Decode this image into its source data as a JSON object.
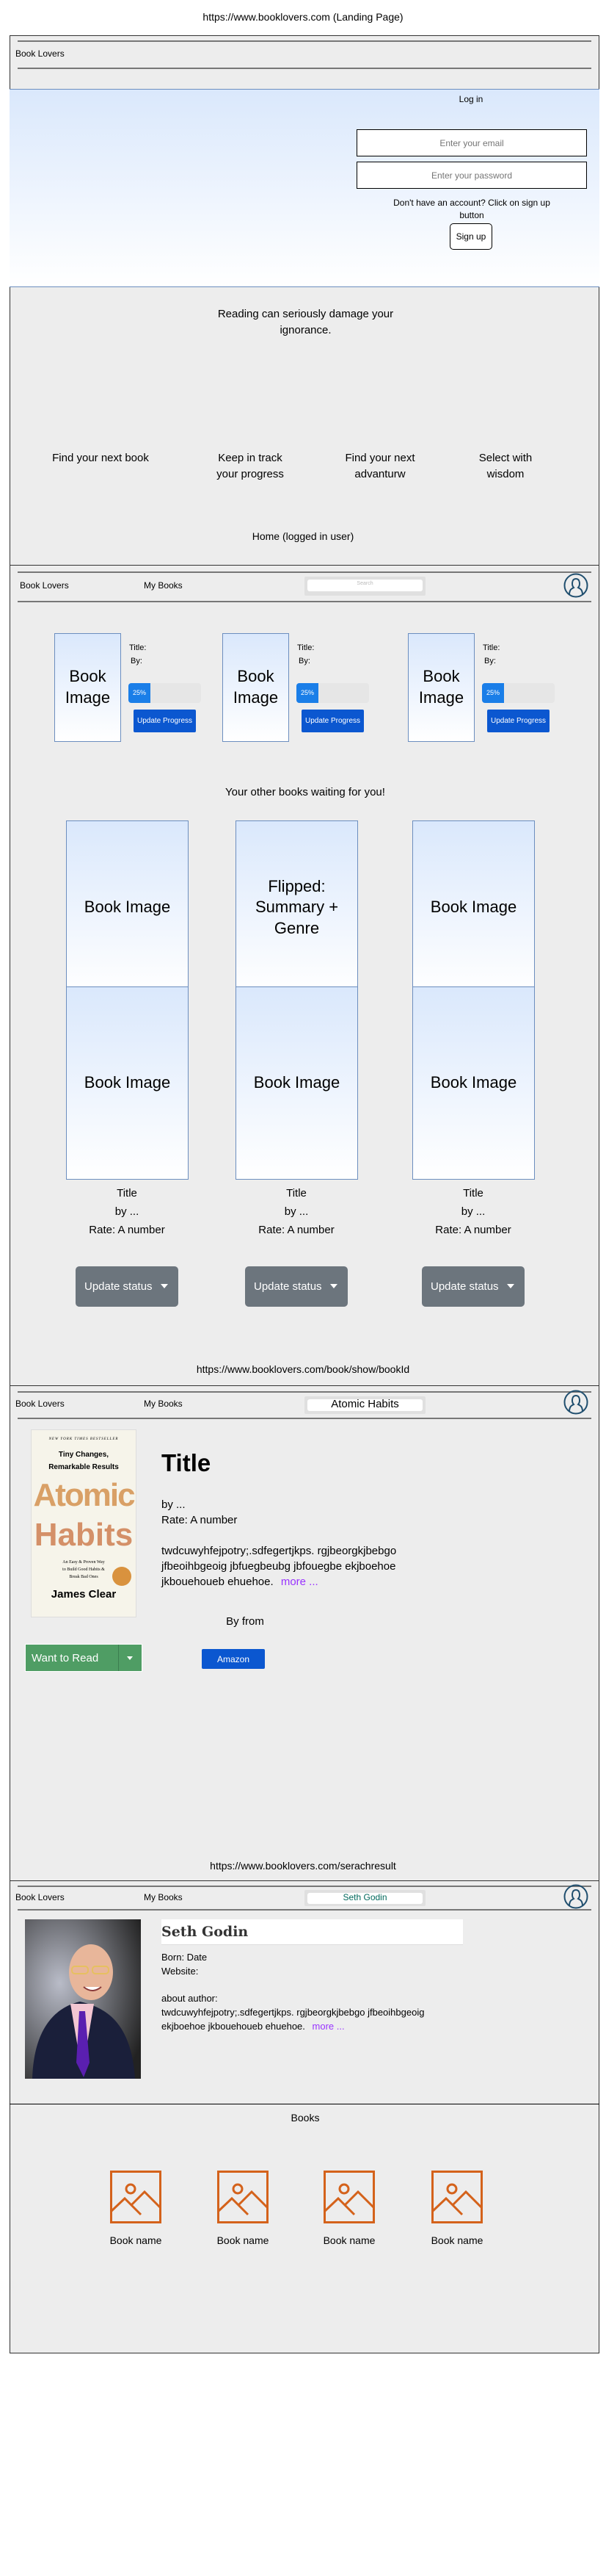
{
  "landing": {
    "caption": "https://www.booklovers.com (Landing Page)",
    "brand": "Book Lovers",
    "login_title": "Log in",
    "email_placeholder": "Enter your email",
    "password_placeholder": "Enter your password",
    "signup_hint": "Don't have an account? Click on sign up button",
    "signup_button": "Sign up",
    "quote": "Reading can seriously damage your ignorance.",
    "features": [
      "Find your next book",
      "Keep in track your progress",
      "Find your next advanturw",
      "Select with wisdom"
    ]
  },
  "home": {
    "caption": "Home (logged in user)",
    "nav": {
      "brand": "Book Lovers",
      "my_books": "My Books",
      "search_placeholder": "Search",
      "avatar_icon": "user-icon"
    },
    "reading": [
      {
        "image": "Book Image",
        "title_label": "Title:",
        "by_label": "By:",
        "progress": 25,
        "progress_label": "25%",
        "button": "Update Progress"
      },
      {
        "image": "Book Image",
        "title_label": "Title:",
        "by_label": "By:",
        "progress": 25,
        "progress_label": "25%",
        "button": "Update Progress"
      },
      {
        "image": "Book Image",
        "title_label": "Title:",
        "by_label": "By:",
        "progress": 25,
        "progress_label": "25%",
        "button": "Update Progress"
      }
    ],
    "other_heading": "Your other books waiting for you!",
    "books": [
      {
        "image": "Book Image",
        "title": "Title",
        "by": "by ...",
        "rate": "Rate: A number",
        "button": "Update status"
      },
      {
        "image": "Flipped: Summary + Genre",
        "title": "Title",
        "by": "by ...",
        "rate": "Rate: A number",
        "button": "Update status"
      },
      {
        "image": "Book Image",
        "title": "Title",
        "by": "by ...",
        "rate": "Rate: A number",
        "button": "Update status"
      },
      {
        "image": "Book Image",
        "title": "Title",
        "by": "by ...",
        "rate": "Rate: A number",
        "button": "Update status"
      },
      {
        "image": "Book Image",
        "title": "Title",
        "by": "by ...",
        "rate": "Rate: A number",
        "button": "Update status"
      },
      {
        "image": "Book Image",
        "title": "Title",
        "by": "by ...",
        "rate": "Rate: A number",
        "button": "Update status"
      }
    ]
  },
  "book": {
    "caption": "https://www.booklovers.com/book/show/bookId",
    "nav": {
      "brand": "Book Lovers",
      "my_books": "My Books",
      "search_value": "Atomic Habits"
    },
    "cover": {
      "top": "NEW YORK TIMES BESTSELLER",
      "tagline": "Tiny Changes, Remarkable Results",
      "title1": "Atomic",
      "title2": "Habits",
      "subtitle": "An Easy & Proven Way to Build Good Habits & Break Bad Ones",
      "author": "James Clear"
    },
    "title": "Title",
    "by": "by ...",
    "rate": "Rate: A number",
    "description": "twdcuwyhfejpotry;.sdfegertjkps. rgjbeorgkjbebgo jfbeoihbgeoig jbfuegbeubg jbfouegbe ekjboehoe jkbouehoueb ehuehoe.",
    "more": "more ...",
    "by_from": "By from",
    "amazon": "Amazon",
    "want_to_read": "Want to Read",
    "colors": {
      "want": "#4f9d64",
      "link": "#9933ff",
      "amazon": "#0b57d0"
    }
  },
  "author": {
    "caption": "https://www.booklovers.com/serachresult",
    "nav": {
      "brand": "Book Lovers",
      "my_books": "My Books",
      "search_value": "Seth Godin"
    },
    "name": "Seth Godin",
    "born": "Born: Date",
    "website": "Website:",
    "about_label": "about author:",
    "about": "twdcuwyhfejpotry;.sdfegertjkps. rgjbeorgkjbebgo jfbeoihbgeoig ekjboehoe jkbouehoueb ehuehoe.",
    "more": "more ...",
    "books_heading": "Books",
    "books": [
      "Book name",
      "Book name",
      "Book name",
      "Book name"
    ]
  }
}
